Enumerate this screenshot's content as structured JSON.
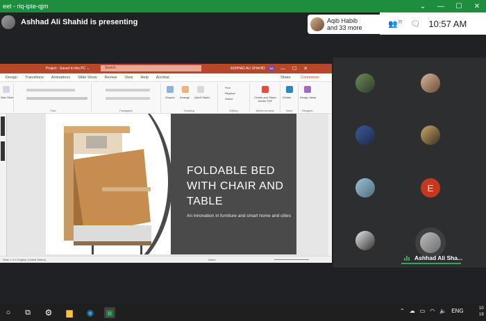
{
  "browser": {
    "tab_title": "eet - riq-ipte-qjm",
    "controls": [
      "⌄",
      "—",
      "☐",
      "✕"
    ]
  },
  "meet": {
    "presenting_text": "Ashhad Ali Shahid is presenting",
    "people_chip": {
      "name": "Aqib Habib",
      "more": "and 33 more"
    },
    "people_count": "35",
    "time": "10:57 AM"
  },
  "ppt": {
    "title": "Project - Saved to this PC ⌄",
    "search": "Search",
    "user": "ASHHAD ALI SHAHID",
    "user_initials": "AA",
    "menu": [
      "Design",
      "Transitions",
      "Animations",
      "Slide Show",
      "Review",
      "View",
      "Help",
      "Acrobat"
    ],
    "share": "Share",
    "comments": "Comments",
    "ribbon_groups": [
      "Font",
      "Paragraph",
      "Drawing",
      "Editing",
      "Adobe Acrobat",
      "Voice",
      "Designer"
    ],
    "ribbon_labels": {
      "new_slide": "New Slide",
      "shapes": "Shapes",
      "arrange": "Arrange",
      "quick_styles": "Quick Styles",
      "find": "Find",
      "replace": "Replace",
      "select": "Select",
      "create_share": "Create and Share Adobe PDF",
      "dictate": "Dictate",
      "design_ideas": "Design Ideas"
    },
    "slide": {
      "title": "FOLDABLE BED WITH CHAIR AND TABLE",
      "subtitle": "An innovation in furniture and smart home and cities"
    },
    "status_left": "Slide 1 of 1   English (United States)",
    "status_right": "Notes"
  },
  "tiles": {
    "letter_avatar": "E",
    "self_name": "Ashhad Ali Sha..."
  },
  "taskbar": {
    "tray_lang": "ENG",
    "clock_line1": "10",
    "clock_line2": "19"
  }
}
